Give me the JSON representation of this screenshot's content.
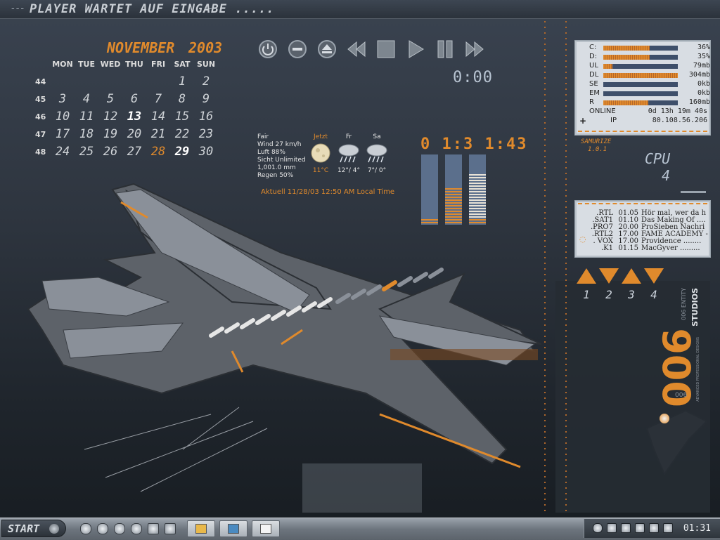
{
  "topbar": {
    "dash_left": "---",
    "player_status": "PLAYER WARTET AUF EINGABE .....",
    "dash_right": "---"
  },
  "calendar": {
    "month": "NOVEMBER",
    "year": "2003",
    "weekdays": [
      "MON",
      "TUE",
      "WED",
      "THU",
      "FRI",
      "SAT",
      "SUN"
    ],
    "weeks": [
      {
        "num": "44",
        "days": [
          "",
          "",
          "",
          "",
          "",
          "1",
          "2"
        ]
      },
      {
        "num": "45",
        "days": [
          "3",
          "4",
          "5",
          "6",
          "7",
          "8",
          "9"
        ]
      },
      {
        "num": "46",
        "days": [
          "10",
          "11",
          "12",
          "13",
          "14",
          "15",
          "16"
        ]
      },
      {
        "num": "47",
        "days": [
          "17",
          "18",
          "19",
          "20",
          "21",
          "22",
          "23"
        ]
      },
      {
        "num": "48",
        "days": [
          "24",
          "25",
          "26",
          "27",
          "28",
          "29",
          "30"
        ]
      }
    ],
    "today": "28",
    "highlight_white": [
      "13",
      "29"
    ]
  },
  "player": {
    "buttons": [
      "power-icon",
      "minus-icon",
      "eject-icon",
      "rewind-icon",
      "stop-icon",
      "play-icon",
      "pause-icon",
      "fast-forward-icon"
    ],
    "time": "0:00"
  },
  "weather": {
    "lines": [
      "Fair",
      "Wind 27 km/h",
      "Luft 88%",
      "Sicht Unlimited",
      "1,001.0 mm",
      "Regen 50%"
    ],
    "days": [
      {
        "label": "Jetzt",
        "temp": "11°C",
        "icon": "moon-icon"
      },
      {
        "label": "Fr",
        "temp": "12°/ 4°",
        "icon": "rain-cloud-icon"
      },
      {
        "label": "Sa",
        "temp": "7°/ 0°",
        "icon": "rain-cloud-icon"
      }
    ],
    "updated": "Aktuell 11/28/03 12:50 AM Local Time"
  },
  "clock": {
    "time": "0 1:3 1:43",
    "bar_levels": [
      0,
      0.52,
      0.72
    ]
  },
  "system": {
    "rows": [
      {
        "label": "C:",
        "value": "36%",
        "level": 0.62
      },
      {
        "label": "D:",
        "value": "35%",
        "level": 0.62
      },
      {
        "label": "UL",
        "value": "79mb",
        "level": 0.12
      },
      {
        "label": "DL",
        "value": "304mb",
        "level": 1.0
      },
      {
        "label": "SE",
        "value": "0kb",
        "level": 0
      },
      {
        "label": "EM",
        "value": "0kb",
        "level": 0
      },
      {
        "label": "R",
        "value": "160mb",
        "level": 0.6
      }
    ],
    "online_label": "ONLINE",
    "online_value": "0d 13h 19m 40s",
    "ip_label": "IP",
    "ip_value": "80.108.56.206"
  },
  "samurize": {
    "name": "SAMURIZE",
    "version": "1.0.1"
  },
  "cpu": {
    "label": "CPU",
    "value": "4"
  },
  "tv": {
    "rows": [
      {
        "channel": ".RTL",
        "time": "01.05",
        "title": "Hör mal, wer da h"
      },
      {
        "channel": ".SAT1",
        "time": "01.10",
        "title": "Das Making Of ...."
      },
      {
        "channel": ".PRO7",
        "time": "20.00",
        "title": "ProSieben Nachri"
      },
      {
        "channel": ".RTL2",
        "time": "17.00",
        "title": "FAME ACADEMY -"
      },
      {
        "channel": ". VOX",
        "time": "17.00",
        "title": "Providence ........"
      },
      {
        "channel": ".K1",
        "time": "01.15",
        "title": "MacGyver ........."
      }
    ]
  },
  "desktops": {
    "numbers": [
      "1",
      "2",
      "3",
      "4"
    ]
  },
  "branding": {
    "name": "006",
    "sub": "STUDIOS",
    "entity": "006 ENTITY",
    "small": "006",
    "tagline": "ADVANCED PROFESSIONAL DESIGNS"
  },
  "taskbar": {
    "start_label": "START",
    "quick_icons": [
      "media-icon",
      "power-icon",
      "globe-icon",
      "gear-icon",
      "home-icon",
      "trash-icon"
    ],
    "buttons": [
      "folder-icon",
      "picture-icon",
      "document-icon"
    ],
    "tray_icons": [
      "network-icon",
      "bluetooth-icon",
      "settings-icon",
      "pen-icon",
      "monitor-icon",
      "mail-icon"
    ],
    "clock": "01:31"
  },
  "colors": {
    "accent": "#e08a2c",
    "panel": "#d8dde3",
    "background": "#2e353f"
  }
}
